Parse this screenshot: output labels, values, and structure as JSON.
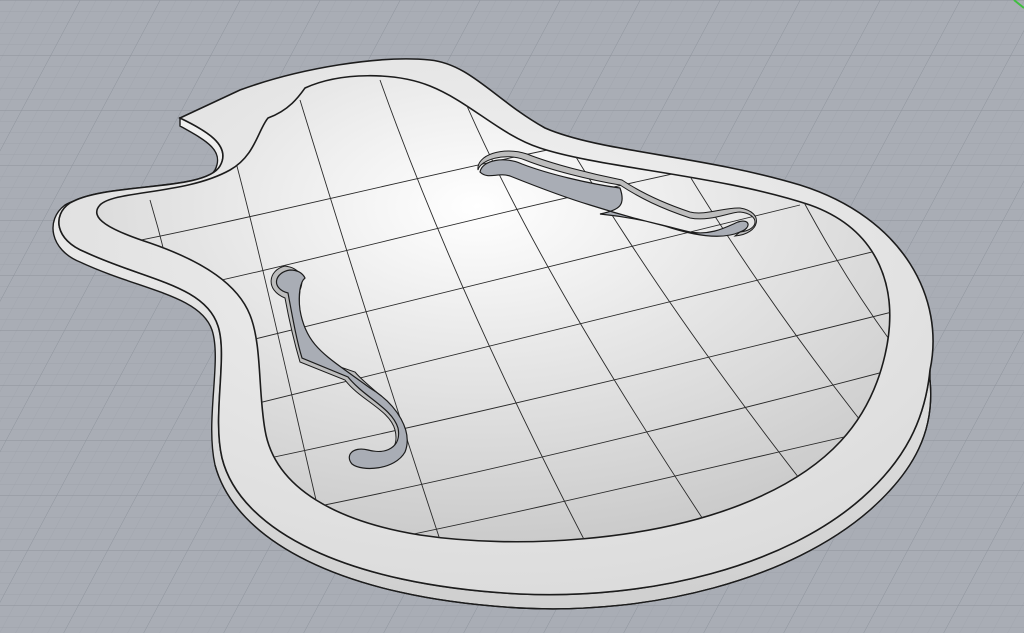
{
  "viewport": {
    "kind": "perspective-3d-view",
    "object": "archtop-guitar-top-with-f-holes",
    "colors": {
      "background": "#a9adb5",
      "grid_minor": "#9ba0a8",
      "grid_major": "#8d929b",
      "surface_light": "#f3f3f3",
      "surface_mid": "#dedede",
      "surface_dark": "#c6c6c6",
      "edge": "#1c1c1c",
      "wall": "#e9e9e9",
      "wall_shadow": "#bdbdbd",
      "axis_green": "#3fbf3f"
    }
  }
}
